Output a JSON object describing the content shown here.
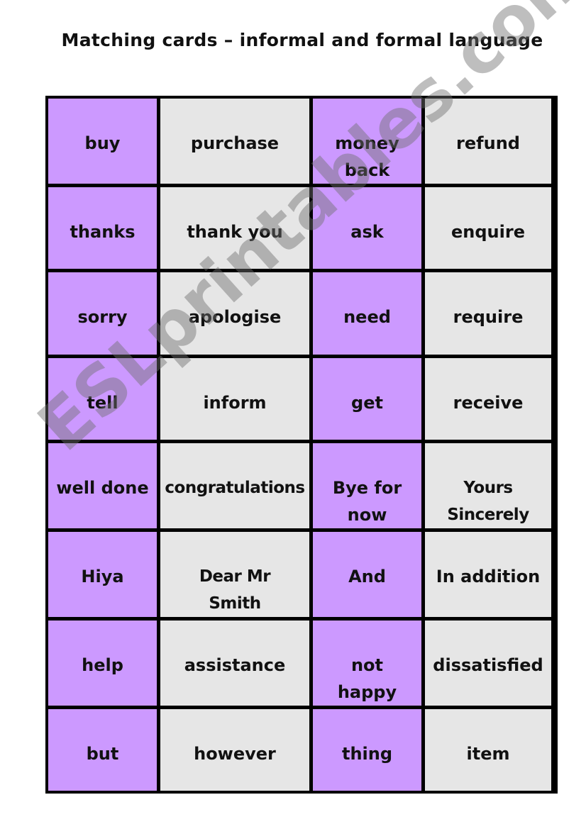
{
  "title": "Matching cards – informal and formal language",
  "watermark": "ESLprintables.com",
  "colors": {
    "informal": "#cc99ff",
    "formal": "#e6e6e6",
    "border": "#000000"
  },
  "rows": [
    {
      "informal_1": "buy",
      "formal_1": "purchase",
      "informal_2": "money back",
      "formal_2": "refund"
    },
    {
      "informal_1": "thanks",
      "formal_1": "thank you",
      "informal_2": "ask",
      "formal_2": "enquire"
    },
    {
      "informal_1": "sorry",
      "formal_1": "apologise",
      "informal_2": "need",
      "formal_2": "require"
    },
    {
      "informal_1": "tell",
      "formal_1": "inform",
      "informal_2": "get",
      "formal_2": "receive"
    },
    {
      "informal_1": "well done",
      "formal_1": "congratulations",
      "informal_2": "Bye for now",
      "formal_2": "Yours Sincerely"
    },
    {
      "informal_1": "Hiya",
      "formal_1": "Dear Mr Smith",
      "informal_2": "And",
      "formal_2": "In addition"
    },
    {
      "informal_1": "help",
      "formal_1": "assistance",
      "informal_2": "not happy",
      "formal_2": "dissatisfied"
    },
    {
      "informal_1": "but",
      "formal_1": "however",
      "informal_2": "thing",
      "formal_2": "item"
    }
  ]
}
